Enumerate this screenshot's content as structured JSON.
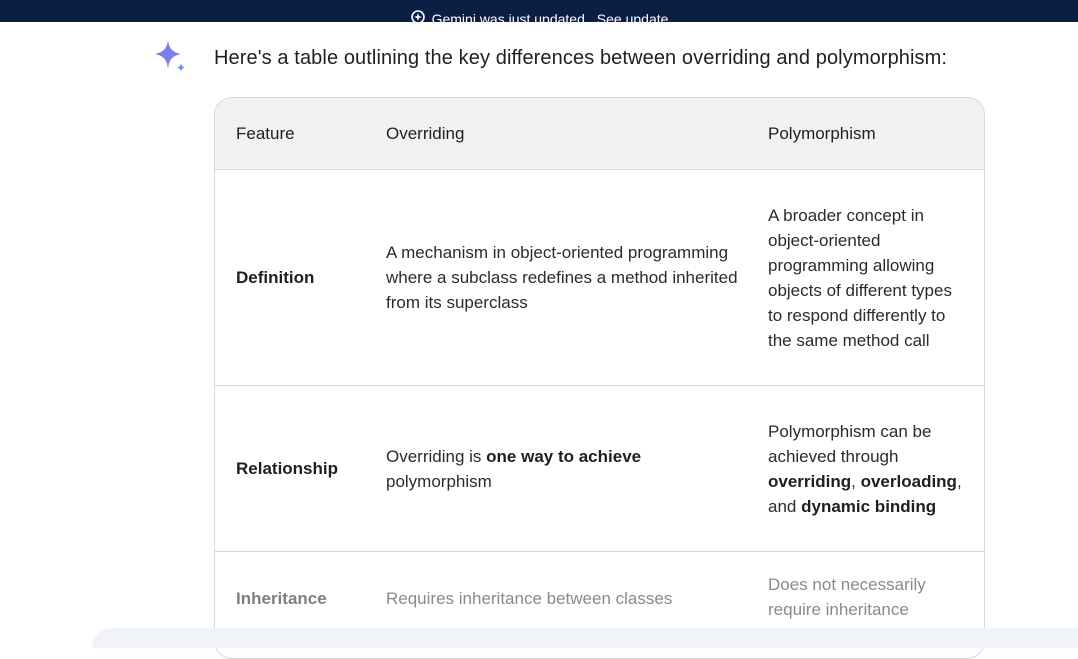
{
  "banner": {
    "message": "Gemini was just updated.",
    "link": "See update",
    "icon": "sparkle-badge-icon"
  },
  "assistant_icon": "gemini-sparkle-icon",
  "intro_text": "Here's a table outlining the key differences between overriding and polymorphism:",
  "colors": {
    "banner_bg": "#0b1f45",
    "header_bg": "#f1f1f1",
    "border": "#d7d7d7",
    "spark_start": "#4f86f7",
    "spark_end": "#a77ad8"
  },
  "table": {
    "headers": [
      "Feature",
      "Overriding",
      "Polymorphism"
    ],
    "rows": [
      {
        "feature": "Definition",
        "overriding": "A mechanism in object-oriented programming where a subclass redefines a method inherited from its superclass",
        "polymorphism": "A broader concept in object-oriented programming allowing objects of different types to respond differently to the same method call"
      },
      {
        "feature": "Relationship",
        "overriding_pre": "Overriding is",
        "overriding_bold": "one way to achieve",
        "overriding_post": "polymorphism",
        "poly_pre": "Polymorphism can be achieved through",
        "poly_b1": "overriding",
        "poly_sep1": ",",
        "poly_b2": "overloading",
        "poly_sep2": ", and",
        "poly_b3": "dynamic binding"
      },
      {
        "feature": "Inheritance",
        "overriding": "Requires inheritance between classes",
        "polymorphism": "Does not necessarily require inheritance"
      }
    ]
  }
}
